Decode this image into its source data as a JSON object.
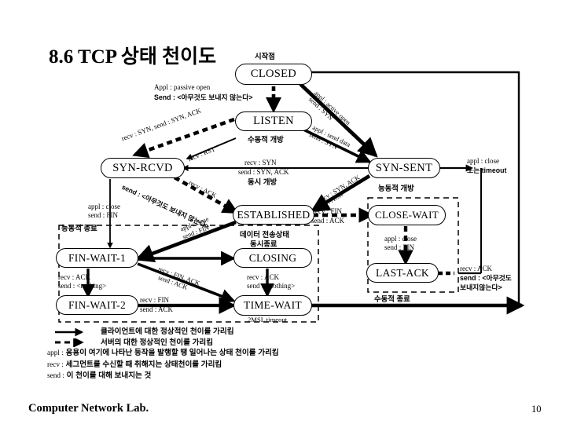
{
  "title": "8.6 TCP 상태 천이도",
  "footer": {
    "lab": "Computer Network Lab.",
    "page": "10"
  },
  "states": [
    {
      "id": "closed",
      "label": "CLOSED"
    },
    {
      "id": "listen",
      "label": "LISTEN"
    },
    {
      "id": "syn-rcvd",
      "label": "SYN-RCVD"
    },
    {
      "id": "syn-sent",
      "label": "SYN-SENT"
    },
    {
      "id": "established",
      "label": "ESTABLISHED"
    },
    {
      "id": "close-wait",
      "label": "CLOSE-WAIT"
    },
    {
      "id": "fin-wait-1",
      "label": "FIN-WAIT-1"
    },
    {
      "id": "fin-wait-2",
      "label": "FIN-WAIT-2"
    },
    {
      "id": "closing",
      "label": "CLOSING"
    },
    {
      "id": "time-wait",
      "label": "TIME-WAIT"
    },
    {
      "id": "last-ack",
      "label": "LAST-ACK"
    }
  ],
  "annotations": {
    "start_point": "시작점",
    "passive_open_appl": "Appl : passive open",
    "passive_open_send": "Send : <아무것도 보내지 않는다>",
    "active_open_appl": "appl : active open",
    "active_open_send": "send : SYN",
    "send_data_appl": "appl : send data",
    "send_data_send": "send : SYN",
    "recv_syn_send_synack_diag": "recv : SYN, send : SYN, ACK",
    "recv_rst": "recv : RST",
    "passive_open_ko": "수동적 개방",
    "simul_open_recv": "recv : SYN",
    "simul_open_send": "send : SYN, ACK",
    "simul_open_ko": "동시 개방",
    "active_open_ko": "능동적 개방",
    "syn_sent_close": "appl : close",
    "syn_sent_timeout": "또는 timeout",
    "synrcvd_est_send": "send : <아무것도 보내지 않는다>",
    "synrcvd_est_recv": "recv : ACK",
    "appl_close_fin_left_1": "appl : close",
    "appl_close_fin_left_2": "send : FIN",
    "active_close_ko": "능동적 종료",
    "established_data_ko": "데이터 전송상태",
    "simul_close_ko": "동시종료",
    "recv_syn_ack_diag": "recv : SYN, ACK",
    "send_ack_diag": "send : ACK",
    "est_cw_recv": "recv : FIN",
    "est_cw_send": "send : ACK",
    "appl_close_diag_1": "appl : close",
    "appl_close_diag_2": "send : FIN",
    "fw1_fw2_recv": "recv : ACK",
    "fw1_fw2_send": "send : <nothing>",
    "fw1_closing_recv": "recv : FIN, ACK",
    "fw1_closing_send": "send : ACK",
    "fw2_tw_recv": "recv : FIN",
    "fw2_tw_send": "send : ACK",
    "closing_tw_recv": "recv : ACK",
    "closing_tw_send": "send : <nothing>",
    "time_wait_note": "2MSL timeout",
    "cw_lastack_appl": "appl : close",
    "cw_lastack_send": "send : FIN",
    "lastack_recv": "recv : ACK",
    "lastack_send_1": "send : <아무것도",
    "lastack_send_2": "보내지않는다>",
    "passive_close_ko": "수동적 종료"
  },
  "legend": {
    "solid_arrow_text": "클라이언트에 대한 정상적인 천이를 가리킴",
    "dashed_arrow_text": "서버의 대한 정상적인 천이를 가리킴",
    "appl_tag": "appl :",
    "appl_text": "응용이 여기에 나타난 등작을 발행할 땡 일어나는 상태 천이를 가리킴",
    "recv_tag": "recv :",
    "recv_text": "세그먼트를 수신할 때 취해지는 상태천이를 가리킴",
    "send_tag": "send :",
    "send_text": "이 천이를 대해 보내지는 것"
  }
}
